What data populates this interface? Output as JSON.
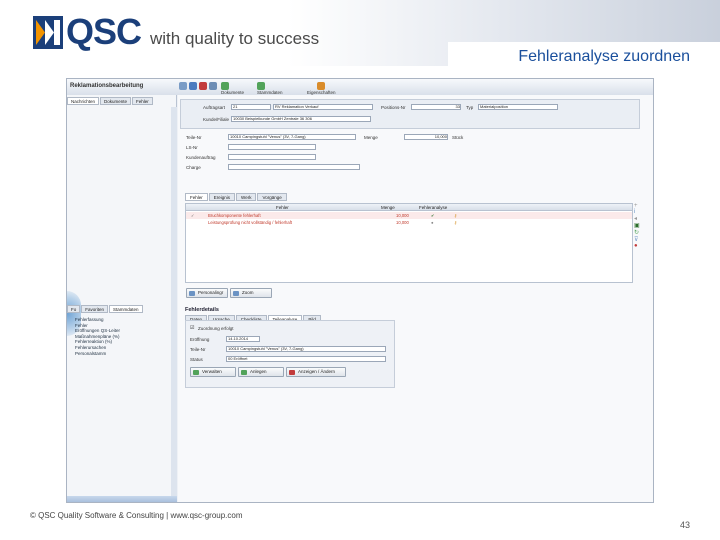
{
  "brand": {
    "logo_text": "QSC",
    "tagline": "with quality to success"
  },
  "slide": {
    "title": "Fehleranalyse zuordnen",
    "footer": "© QSC Quality Software & Consulting | www.qsc-group.com",
    "page_number": "43"
  },
  "app": {
    "window_title": "Reklamationsbearbeitung",
    "toolbar": [
      "Dokumente",
      "Stammdaten",
      "Eigenschaften"
    ],
    "left_tabs": [
      "Nachrichten",
      "Dokumente",
      "Fehler"
    ],
    "left_tabs2": [
      "Fo",
      "Favoriten",
      "Stammdaten"
    ],
    "tree": [
      "Fehlerfassung",
      "Fehler",
      "Eröffnungen QS-Leiter",
      "Maßnahmenpläne (%)",
      "Fehlerreaktion (%)",
      "Fehlerursachen",
      "Personalstamm"
    ],
    "header": {
      "auftragsart_label": "Auftragsart",
      "auftragsart_value": "21",
      "auftragsart_text": "RV Reklamation Verkauf",
      "positions_label": "Positions-Nr",
      "positions_value": "33",
      "typ_label": "Typ",
      "typ_value": "Materialposition",
      "kunde_label": "Kunde/Filiale",
      "kunde_value": "10030  Beispielkunde GmbH Zentrale 36 306"
    },
    "fields": {
      "teile_label": "Teile-Nr",
      "teile_value": "10010 Campingstuhl \"Venus\" (3V, 7-Gang)",
      "menge_label": "Menge",
      "menge_value": "10,000",
      "menge_unit": "Stück",
      "lsnr_label": "LS-Nr",
      "kunden_label": "Kundenauftrag",
      "charge_label": "Charge"
    },
    "tabs": [
      "Fehler",
      "Ereignis",
      "Werk",
      "Vorgänge"
    ],
    "grid": {
      "headers": [
        "Fehler",
        "Menge",
        "Fehleranalyse"
      ],
      "rows": [
        {
          "fehler": "Bruchkomponente fehlerhaft",
          "menge": "10,000"
        },
        {
          "fehler": "Leistungsprüfung nicht vollständig / fehlerhaft",
          "menge": "10,000"
        }
      ]
    },
    "grid_buttons": [
      "Personalingr",
      "Zoom"
    ],
    "detail_title": "Fehlerdetails",
    "detail_tabs": [
      "Daten",
      "Ursache",
      "Checkliste",
      "Teileanalyse",
      "Bild"
    ],
    "detail": {
      "checkbox_label": "Zuordnung erfolgt",
      "eroeffnung_label": "Eröffnung",
      "eroeffnung_value": "14.10.2014",
      "teile_label": "Teile-Nr",
      "teile_value": "10010 Campingstuhl \"Venus\" (3V, 7-Gang)",
      "status_label": "Status",
      "status_value": "00 Eröffnet"
    },
    "detail_buttons": [
      "Verwalten",
      "Anlegen",
      "Anzeigen / Ändern"
    ]
  },
  "colors": {
    "brand_blue": "#1b3f7a",
    "title_blue": "#1a4f9c",
    "row_red": "#c0392b"
  }
}
